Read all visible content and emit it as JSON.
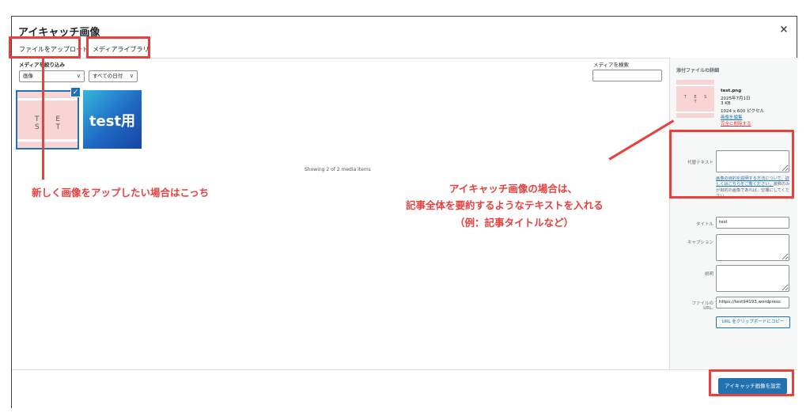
{
  "modal": {
    "title": "アイキャッチ画像",
    "close_icon": "×"
  },
  "tabs": {
    "upload": "ファイルをアップロード",
    "library": "メディアライブラリ"
  },
  "filters": {
    "label": "メディアを絞り込み",
    "type_value": "画像",
    "date_value": "すべての日付"
  },
  "search": {
    "label": "メディアを検索",
    "value": ""
  },
  "media_items": [
    {
      "thumb_text": "T E S T",
      "selected": true
    },
    {
      "thumb_text": "test用",
      "selected": false
    }
  ],
  "check_icon": "✓",
  "chevron_icon": "∨",
  "showing_text": "Showing 2 of 2 media items",
  "details": {
    "heading": "添付ファイルの詳細",
    "thumb_text": "T E S T",
    "filename": "test.png",
    "date": "2025年7月1日",
    "size": "3 KB",
    "dimensions": "1024 x 600 ピクセル",
    "edit_link": "画像を編集",
    "delete_link": "完全に削除する"
  },
  "fields": {
    "alt_label": "代替テキスト",
    "alt_value": "",
    "alt_help_link": "画像の目的を説明する方法について、詳しくはこちらをご覧ください。",
    "alt_help_rest": "装飾のみが目的の画像であれば、空欄にしてください。",
    "title_label": "タイトル",
    "title_value": "test",
    "caption_label": "キャプション",
    "caption_value": "",
    "desc_label": "説明",
    "desc_value": "",
    "url_label_1": "ファイルの",
    "url_label_2": "URL:",
    "url_value": "https://test94193.wordpress",
    "copy_button": "URL をクリップボードにコピー"
  },
  "footer": {
    "set_button": "アイキャッチ画像を設定"
  },
  "annotations": {
    "upload_note": "新しく画像をアップしたい場合はこっち",
    "featured_note_1": "アイキャッチ画像の場合は、",
    "featured_note_2": "記事全体を要約するようなテキストを入れる",
    "featured_note_3": "（例：記事タイトルなど）",
    "highlight_color": "#e8413d"
  },
  "colors": {
    "accent": "#2271b1",
    "delete": "#d63638"
  }
}
